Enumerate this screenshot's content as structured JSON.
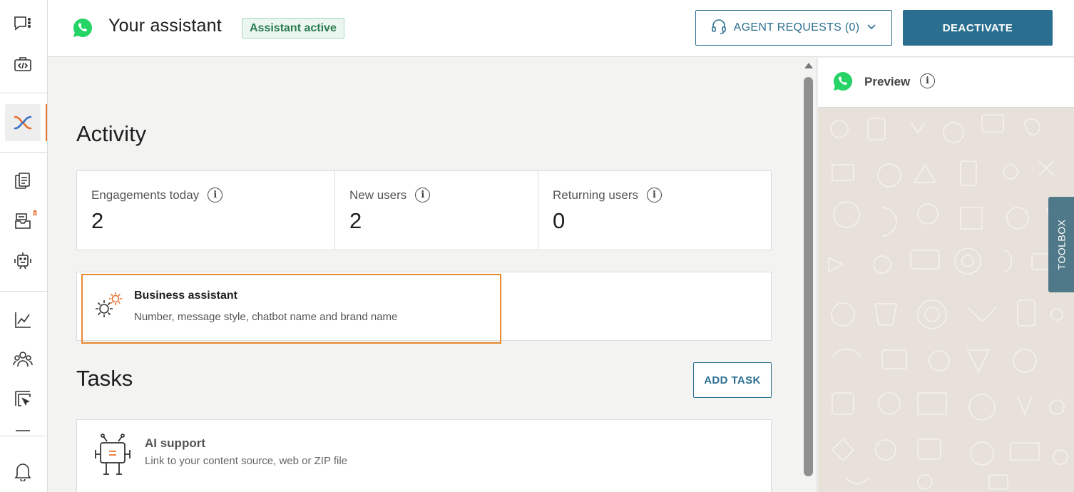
{
  "header": {
    "title": "Your assistant",
    "status_badge": "Assistant active",
    "agent_requests_label": "AGENT REQUESTS (0)",
    "deactivate_label": "DEACTIVATE"
  },
  "activity": {
    "heading": "Activity",
    "stats": [
      {
        "label": "Engagements today",
        "value": "2"
      },
      {
        "label": "New users",
        "value": "2"
      },
      {
        "label": "Returning users",
        "value": "0"
      }
    ]
  },
  "business_assistant": {
    "title": "Business assistant",
    "subtitle": "Number, message style, chatbot name and brand name"
  },
  "tasks": {
    "heading": "Tasks",
    "add_task_label": "ADD TASK",
    "items": [
      {
        "title": "AI support",
        "subtitle": "Link to your content source, web or ZIP file"
      }
    ]
  },
  "preview": {
    "title": "Preview"
  },
  "toolbox": {
    "label": "TOOLBOX"
  },
  "colors": {
    "accent": "#2b6f90",
    "highlight": "#e8892f",
    "whatsapp": "#25d366",
    "status_green": "#2a7a4f"
  },
  "icons": {
    "rail": [
      "chat-menu-icon",
      "code-box-icon",
      "conversation-logo-icon",
      "documents-icon",
      "inbox-icon",
      "robot-icon",
      "analytics-icon",
      "people-icon",
      "cursor-box-icon",
      "bell-icon"
    ]
  }
}
